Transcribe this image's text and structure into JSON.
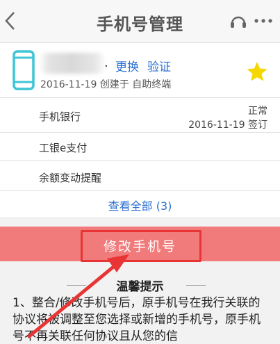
{
  "header": {
    "title": "手机号管理"
  },
  "phone_card": {
    "number_suffix": ".",
    "change_link": "更换",
    "verify_link": "验证",
    "created_info": "2016-11-19 创建于 自助终端"
  },
  "services": [
    {
      "label": "手机银行",
      "status": "正常",
      "date_status": "2016-11-19 签订"
    },
    {
      "label": "工银e支付"
    },
    {
      "label": "余额变动提醒"
    }
  ],
  "view_all": "查看全部 (3)",
  "modify_button": "修改手机号",
  "tips": {
    "title": "温馨提示",
    "body": "1、整合/修改手机号后，原手机号在我行关联的协议将被调整至您选择或新增的手机号，原手机号不再关联任何协议且从您的信"
  },
  "colors": {
    "accent_blue": "#2b6fd1",
    "button_red": "#f17b7b",
    "highlight_red": "#e83434",
    "phone_icon": "#3ec5d6",
    "star": "#f5d800"
  }
}
